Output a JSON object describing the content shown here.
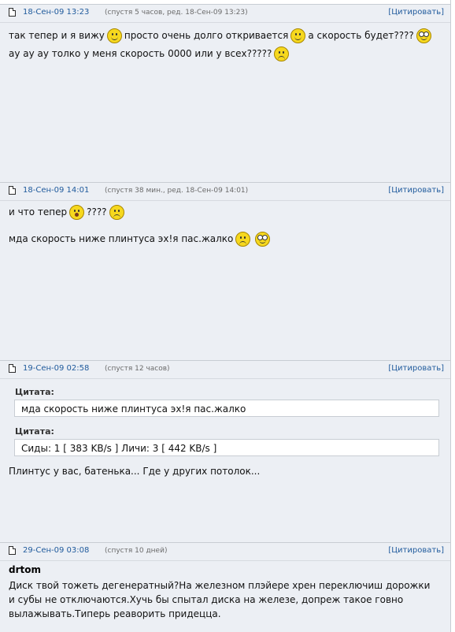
{
  "posts": [
    {
      "date": "18-Сен-09 13:23",
      "meta": "(спустя 5 часов, ред. 18-Сен-09 13:23)",
      "quote_label": "[Цитировать]",
      "lines": [
        [
          "так тепер и я вижу",
          "smile-icon",
          "просто очень долго откривается",
          "smile-icon",
          "а скорость будет????",
          "rolleyes-icon"
        ],
        [
          "ау ау ау толко у меня скорость 0000 или у всех?????",
          "sad-icon"
        ]
      ]
    },
    {
      "date": "18-Сен-09 14:01",
      "meta": "(спустя 38 мин., ред. 18-Сен-09 14:01)",
      "quote_label": "[Цитировать]",
      "line1_text": "и что тепер",
      "line1_text2": "????",
      "line2_text": "мда скорость ниже плинтуса эх!я пас.жалко"
    },
    {
      "date": "19-Сен-09 02:58",
      "meta": "(спустя 12 часов)",
      "quote_label": "[Цитировать]",
      "quote1_label": "Цитата:",
      "quote1_text": "мда скорость ниже плинтуса эх!я пас.жалко",
      "quote2_label": "Цитата:",
      "quote2_text": "Сиды: 1 [ 383 KB/s ] Личи: 3 [ 442 KB/s ]",
      "text": "Плинтус у вас, батенька... Где у других потолок..."
    },
    {
      "date": "29-Сен-09 03:08",
      "meta": "(спустя 10 дней)",
      "quote_label": "[Цитировать]",
      "author": "drtom",
      "lines": [
        "Диск твой тожеть дегенератный?На железном плэйере хрен переключиш дорожки",
        "и субы не отключаются.Хучь бы спытал диска на железе, допреж такое говно",
        "вылажывать.Типерь реаворить придецца."
      ]
    }
  ],
  "colors": {
    "link": "#1f5a9c",
    "post_bg": "#eceff4",
    "meta": "#6b6b6b"
  }
}
